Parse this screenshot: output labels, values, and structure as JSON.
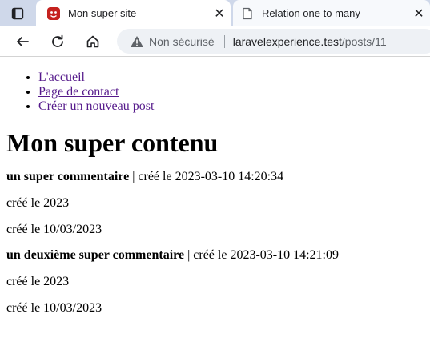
{
  "browser": {
    "tabs": [
      {
        "title": "Mon super site",
        "close": "✕"
      },
      {
        "title": "Relation one to many",
        "close": "✕"
      }
    ],
    "address": {
      "security_label": "Non sécurisé",
      "host": "laravelexperience.test",
      "path": "/posts/11"
    }
  },
  "page": {
    "nav": [
      {
        "label": "L'accueil"
      },
      {
        "label": "Page de contact"
      },
      {
        "label": "Créer un nouveau post"
      }
    ],
    "title": "Mon super contenu",
    "comments": [
      {
        "content": "un super commentaire",
        "separator": " | ",
        "created_line": "créé le 2023-03-10 14:20:34",
        "year_line": "créé le 2023",
        "date_line": "créé le 10/03/2023"
      },
      {
        "content": "un deuxième super commentaire",
        "separator": " | ",
        "created_line": "créé le 2023-03-10 14:21:09",
        "year_line": "créé le 2023",
        "date_line": "créé le 10/03/2023"
      }
    ]
  },
  "colors": {
    "tabstrip": "#cfd8ea",
    "favicon": "#c5221f",
    "link_visited": "#551a8b"
  }
}
